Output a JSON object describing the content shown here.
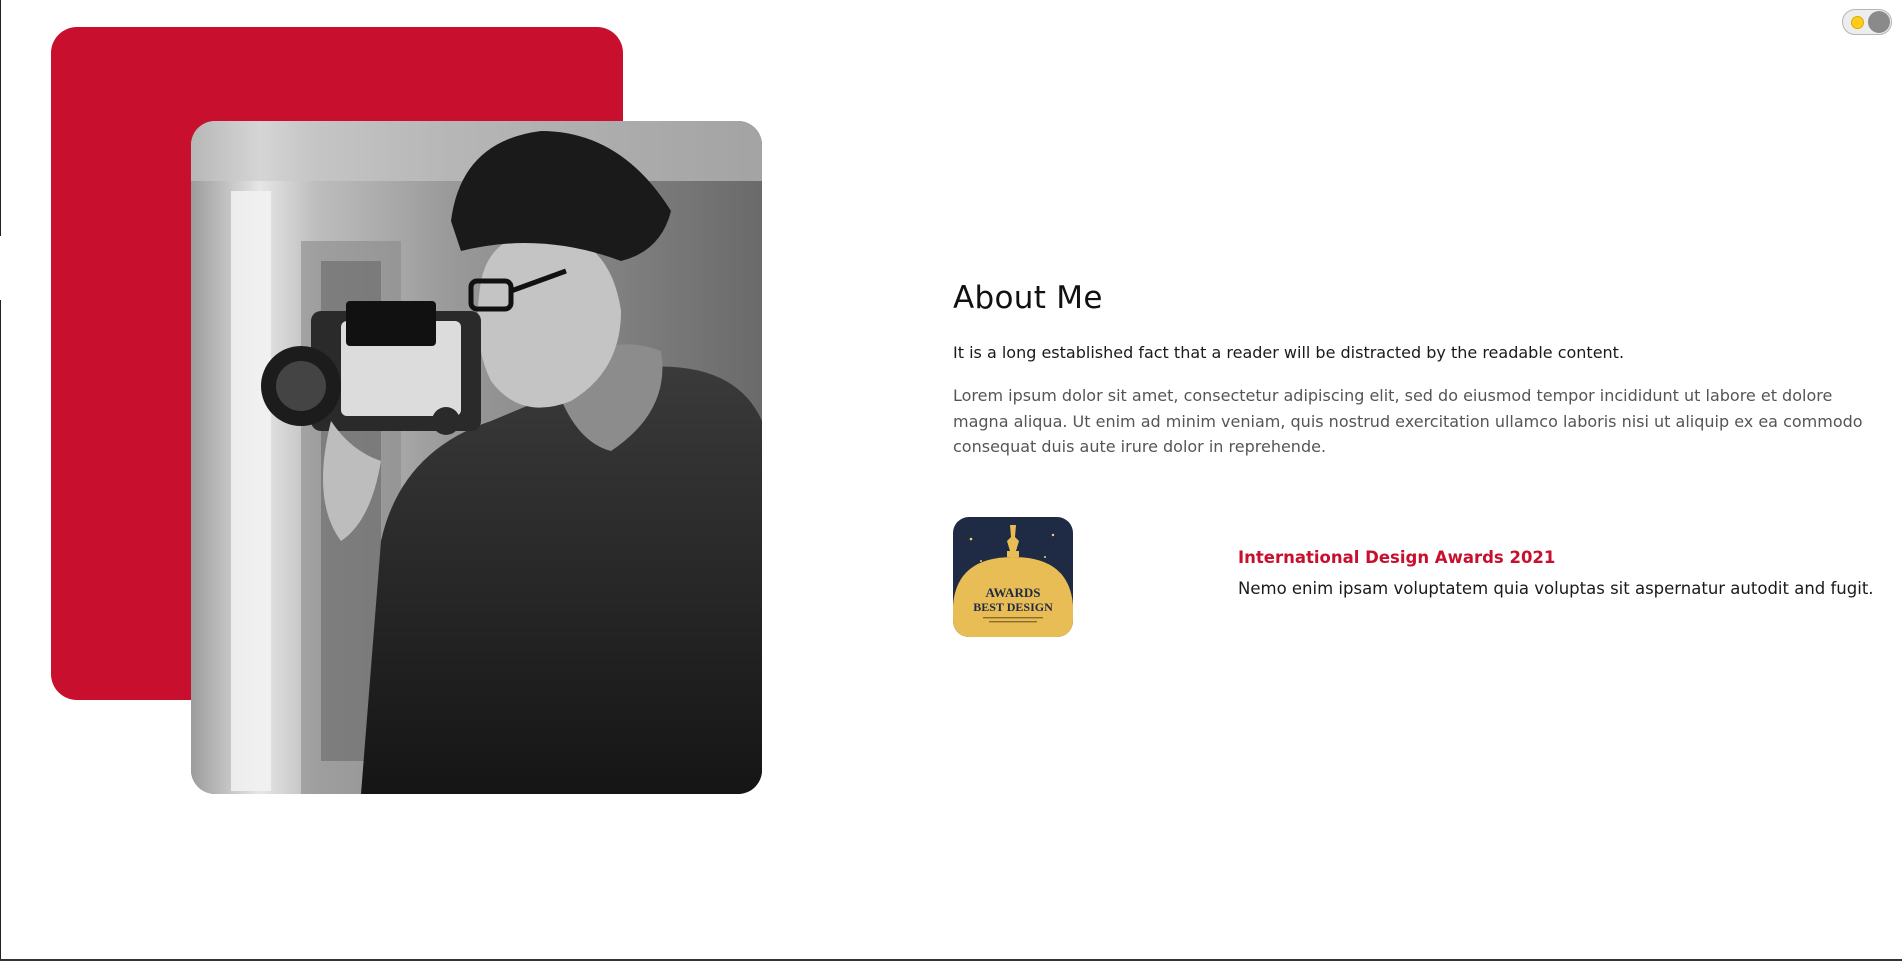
{
  "theme_toggle": {
    "icon": "sun-icon",
    "state": "light"
  },
  "colors": {
    "accent": "#c8102e",
    "badge_navy": "#1f2a44",
    "badge_gold": "#e9bd55"
  },
  "about": {
    "title": "About Me",
    "lead": "It is a long established fact that a reader will be distracted by the readable content.",
    "body": "Lorem ipsum dolor sit amet, consectetur adipiscing elit, sed do eiusmod tempor incididunt ut labore et dolore magna aliqua. Ut enim ad minim veniam, quis nostrud exercitation ullamco laboris nisi ut aliquip ex ea commodo consequat duis aute irure dolor in reprehende."
  },
  "award": {
    "badge": {
      "line1": "AWARDS",
      "line2": "BEST DESIGN"
    },
    "title": "International Design Awards 2021",
    "description": "Nemo enim ipsam voluptatem quia voluptas sit aspernatur autodit and fugit."
  }
}
